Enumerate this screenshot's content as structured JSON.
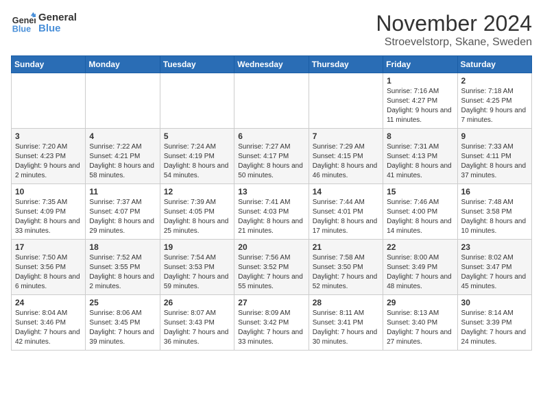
{
  "logo": {
    "line1": "General",
    "line2": "Blue"
  },
  "title": "November 2024",
  "location": "Stroevelstorp, Skane, Sweden",
  "days_of_week": [
    "Sunday",
    "Monday",
    "Tuesday",
    "Wednesday",
    "Thursday",
    "Friday",
    "Saturday"
  ],
  "weeks": [
    [
      {
        "day": "",
        "info": ""
      },
      {
        "day": "",
        "info": ""
      },
      {
        "day": "",
        "info": ""
      },
      {
        "day": "",
        "info": ""
      },
      {
        "day": "",
        "info": ""
      },
      {
        "day": "1",
        "info": "Sunrise: 7:16 AM\nSunset: 4:27 PM\nDaylight: 9 hours and 11 minutes."
      },
      {
        "day": "2",
        "info": "Sunrise: 7:18 AM\nSunset: 4:25 PM\nDaylight: 9 hours and 7 minutes."
      }
    ],
    [
      {
        "day": "3",
        "info": "Sunrise: 7:20 AM\nSunset: 4:23 PM\nDaylight: 9 hours and 2 minutes."
      },
      {
        "day": "4",
        "info": "Sunrise: 7:22 AM\nSunset: 4:21 PM\nDaylight: 8 hours and 58 minutes."
      },
      {
        "day": "5",
        "info": "Sunrise: 7:24 AM\nSunset: 4:19 PM\nDaylight: 8 hours and 54 minutes."
      },
      {
        "day": "6",
        "info": "Sunrise: 7:27 AM\nSunset: 4:17 PM\nDaylight: 8 hours and 50 minutes."
      },
      {
        "day": "7",
        "info": "Sunrise: 7:29 AM\nSunset: 4:15 PM\nDaylight: 8 hours and 46 minutes."
      },
      {
        "day": "8",
        "info": "Sunrise: 7:31 AM\nSunset: 4:13 PM\nDaylight: 8 hours and 41 minutes."
      },
      {
        "day": "9",
        "info": "Sunrise: 7:33 AM\nSunset: 4:11 PM\nDaylight: 8 hours and 37 minutes."
      }
    ],
    [
      {
        "day": "10",
        "info": "Sunrise: 7:35 AM\nSunset: 4:09 PM\nDaylight: 8 hours and 33 minutes."
      },
      {
        "day": "11",
        "info": "Sunrise: 7:37 AM\nSunset: 4:07 PM\nDaylight: 8 hours and 29 minutes."
      },
      {
        "day": "12",
        "info": "Sunrise: 7:39 AM\nSunset: 4:05 PM\nDaylight: 8 hours and 25 minutes."
      },
      {
        "day": "13",
        "info": "Sunrise: 7:41 AM\nSunset: 4:03 PM\nDaylight: 8 hours and 21 minutes."
      },
      {
        "day": "14",
        "info": "Sunrise: 7:44 AM\nSunset: 4:01 PM\nDaylight: 8 hours and 17 minutes."
      },
      {
        "day": "15",
        "info": "Sunrise: 7:46 AM\nSunset: 4:00 PM\nDaylight: 8 hours and 14 minutes."
      },
      {
        "day": "16",
        "info": "Sunrise: 7:48 AM\nSunset: 3:58 PM\nDaylight: 8 hours and 10 minutes."
      }
    ],
    [
      {
        "day": "17",
        "info": "Sunrise: 7:50 AM\nSunset: 3:56 PM\nDaylight: 8 hours and 6 minutes."
      },
      {
        "day": "18",
        "info": "Sunrise: 7:52 AM\nSunset: 3:55 PM\nDaylight: 8 hours and 2 minutes."
      },
      {
        "day": "19",
        "info": "Sunrise: 7:54 AM\nSunset: 3:53 PM\nDaylight: 7 hours and 59 minutes."
      },
      {
        "day": "20",
        "info": "Sunrise: 7:56 AM\nSunset: 3:52 PM\nDaylight: 7 hours and 55 minutes."
      },
      {
        "day": "21",
        "info": "Sunrise: 7:58 AM\nSunset: 3:50 PM\nDaylight: 7 hours and 52 minutes."
      },
      {
        "day": "22",
        "info": "Sunrise: 8:00 AM\nSunset: 3:49 PM\nDaylight: 7 hours and 48 minutes."
      },
      {
        "day": "23",
        "info": "Sunrise: 8:02 AM\nSunset: 3:47 PM\nDaylight: 7 hours and 45 minutes."
      }
    ],
    [
      {
        "day": "24",
        "info": "Sunrise: 8:04 AM\nSunset: 3:46 PM\nDaylight: 7 hours and 42 minutes."
      },
      {
        "day": "25",
        "info": "Sunrise: 8:06 AM\nSunset: 3:45 PM\nDaylight: 7 hours and 39 minutes."
      },
      {
        "day": "26",
        "info": "Sunrise: 8:07 AM\nSunset: 3:43 PM\nDaylight: 7 hours and 36 minutes."
      },
      {
        "day": "27",
        "info": "Sunrise: 8:09 AM\nSunset: 3:42 PM\nDaylight: 7 hours and 33 minutes."
      },
      {
        "day": "28",
        "info": "Sunrise: 8:11 AM\nSunset: 3:41 PM\nDaylight: 7 hours and 30 minutes."
      },
      {
        "day": "29",
        "info": "Sunrise: 8:13 AM\nSunset: 3:40 PM\nDaylight: 7 hours and 27 minutes."
      },
      {
        "day": "30",
        "info": "Sunrise: 8:14 AM\nSunset: 3:39 PM\nDaylight: 7 hours and 24 minutes."
      }
    ]
  ]
}
